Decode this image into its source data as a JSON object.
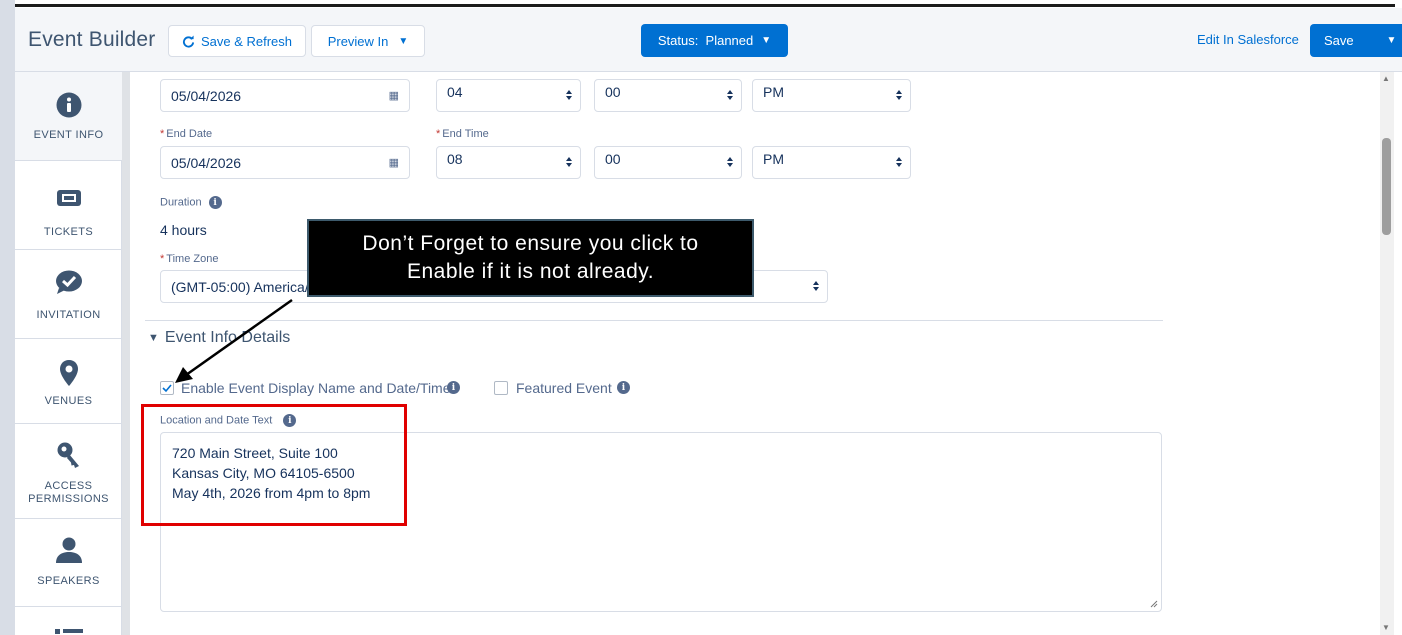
{
  "header": {
    "title": "Event Builder",
    "save_refresh": "Save & Refresh",
    "preview": "Preview In",
    "status": "Status:  Planned",
    "edit_link": "Edit In Salesforce",
    "save": "Save"
  },
  "nav": {
    "items": [
      {
        "label": "EVENT INFO",
        "icon": "info-icon"
      },
      {
        "label": "TICKETS",
        "icon": "ticket-icon"
      },
      {
        "label": "INVITATION",
        "icon": "chat-check-icon"
      },
      {
        "label": "VENUES",
        "icon": "location-pin-icon"
      },
      {
        "label": "ACCESS PERMISSIONS",
        "icon": "key-icon"
      },
      {
        "label": "SPEAKERS",
        "icon": "person-icon"
      }
    ]
  },
  "form": {
    "start_date": "05/04/2026",
    "start_hour": "04",
    "start_minute": "00",
    "start_ampm": "PM",
    "end_date_label": "End Date",
    "end_time_label": "End Time",
    "end_date": "05/04/2026",
    "end_hour": "08",
    "end_minute": "00",
    "end_ampm": "PM",
    "duration_label": "Duration",
    "duration": "4 hours",
    "timezone_label": "Time Zone",
    "timezone": "(GMT-05:00) America/C",
    "section_title": "Event Info Details",
    "enable_label": "Enable Event Display Name and Date/Time",
    "enable_checked": true,
    "featured_label": "Featured Event",
    "featured_checked": false,
    "location_label": "Location and Date Text",
    "location_lines": [
      "720 Main Street, Suite 100",
      "Kansas City, MO 64105-6500",
      "May 4th, 2026 from 4pm to 8pm"
    ]
  },
  "annotation": {
    "callout_line1": "Don’t Forget to ensure you click to",
    "callout_line2": "Enable if it is not already.",
    "highlight_color": "#e00000",
    "arrow_color": "#000000"
  },
  "colors": {
    "brand_blue": "#0070d2",
    "nav_icon": "#3e5570",
    "required": "#c23934"
  }
}
